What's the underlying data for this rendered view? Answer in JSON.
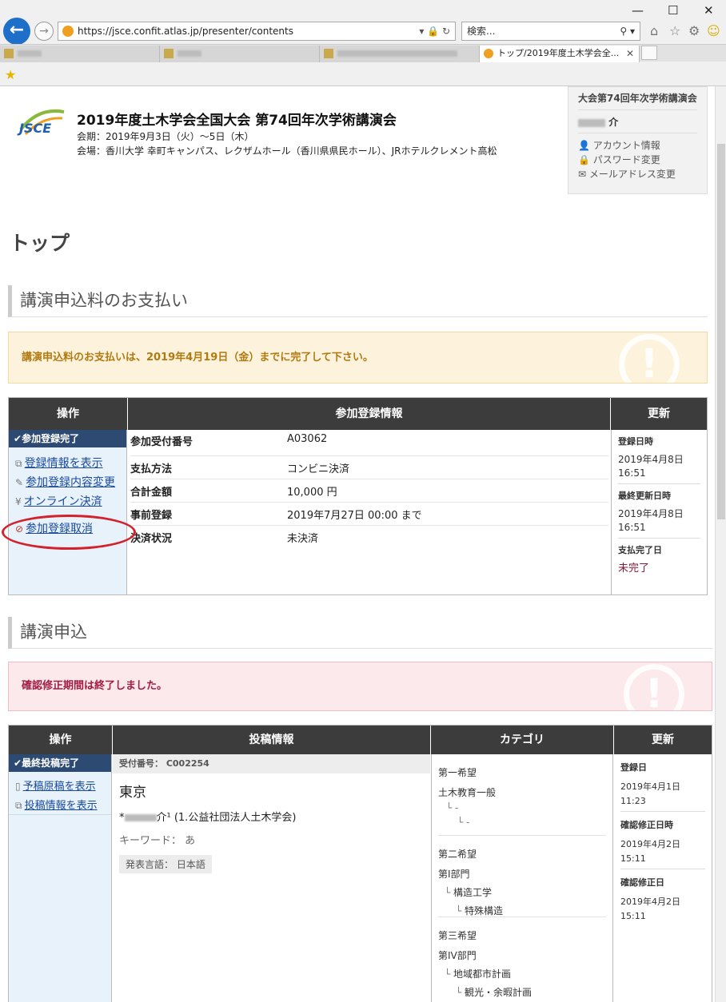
{
  "browser": {
    "url": "https://jsce.confit.atlas.jp/presenter/contents",
    "search_placeholder": "検索...",
    "active_tab_title": "トップ/2019年度土木学会全...",
    "window_controls": [
      "—",
      "☐",
      "✕"
    ]
  },
  "header": {
    "title": "2019年度土木学会全国大会 第74回年次学術講演会",
    "period": "会期：2019年9月3日（火）～5日（木）",
    "venue": "会場：香川大学 幸町キャンパス、レクザムホール（香川県県民ホール）、JRホテルクレメント高松",
    "logo_text": "JSCE"
  },
  "user_box": {
    "event": "大会第74回年次学術講演会",
    "name_suffix": "介",
    "links": [
      "アカウント情報",
      "パスワード変更",
      "メールアドレス変更"
    ]
  },
  "page_title": "トップ",
  "payment_section": {
    "heading": "講演申込料のお支払い",
    "alert": "講演申込料のお支払いは、2019年4月19日（金）までに完了して下さい。",
    "columns": [
      "操作",
      "参加登録情報",
      "更新"
    ],
    "status_badge": "参加登録完了",
    "actions": [
      "登録情報を表示",
      "参加登録内容変更",
      "オンライン決済",
      "参加登録取消"
    ],
    "info": [
      {
        "label": "参加受付番号",
        "value": "A03062"
      },
      {
        "label": "支払方法",
        "value": "コンビニ決済"
      },
      {
        "label": "合計金額",
        "value": "10,000 円"
      },
      {
        "label": "事前登録",
        "value": "2019年7月27日 00:00 まで"
      },
      {
        "label": "決済状況",
        "value": "未決済"
      }
    ],
    "updates": [
      {
        "label": "登録日時",
        "date": "2019年4月8日",
        "time": "16:51"
      },
      {
        "label": "最終更新日時",
        "date": "2019年4月8日",
        "time": "16:51"
      },
      {
        "label": "支払完了日",
        "date": "未完了"
      }
    ]
  },
  "submission_section": {
    "heading": "講演申込",
    "alert": "確認修正期間は終了しました。",
    "columns": [
      "操作",
      "投稿情報",
      "カテゴリ",
      "更新"
    ],
    "status_badge": "最終投稿完了",
    "actions": [
      "予稿原稿を表示",
      "投稿情報を表示"
    ],
    "receipt": "受付番号： C002254",
    "title": "東京",
    "author_suffix": "介¹ (1.公益社団法人土木学会)",
    "keywords": "キーワード： あ",
    "language": "発表言語： 日本語",
    "categories": [
      {
        "label": "第一希望",
        "main": "土木教育一般",
        "sub1": "-",
        "sub2": "-"
      },
      {
        "label": "第二希望",
        "main": "第I部門",
        "sub1": "構造工学",
        "sub2": "特殊構造"
      },
      {
        "label": "第三希望",
        "main": "第IV部門",
        "sub1": "地域都市計画",
        "sub2": "観光・余暇計画"
      }
    ],
    "updates": [
      {
        "label": "登録日",
        "date": "2019年4月1日",
        "time": "11:23"
      },
      {
        "label": "確認修正日時",
        "date": "2019年4月2日",
        "time": "15:11"
      },
      {
        "label": "確認修正日",
        "date": "2019年4月2日",
        "time": "15:11"
      }
    ]
  },
  "colors": {
    "alert_warning_bg": "#fdf3dc",
    "alert_danger_bg": "#fbe9ec",
    "header_dark": "#3c3c3c",
    "badge": "#2d4a72",
    "unpaid": "#8b1a3b"
  }
}
